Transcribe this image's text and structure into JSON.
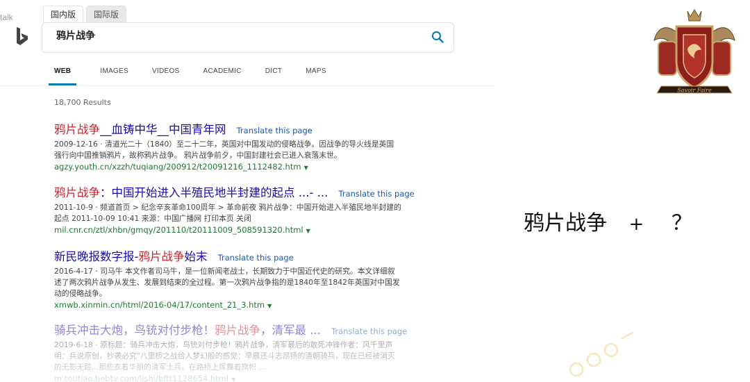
{
  "corner_text": "talk",
  "market_tabs": [
    {
      "label": "国内版"
    },
    {
      "label": "国际版"
    }
  ],
  "search": {
    "value": "鸦片战争"
  },
  "nav": [
    {
      "label": "WEB"
    },
    {
      "label": "IMAGES"
    },
    {
      "label": "VIDEOS"
    },
    {
      "label": "ACADEMIC"
    },
    {
      "label": "DICT"
    },
    {
      "label": "MAPS"
    }
  ],
  "results_count": "18,700 Results",
  "translate_label": "Translate this page",
  "results": [
    {
      "title_parts": [
        "鸦片战争",
        "__血铸中华__中国青年网"
      ],
      "snippet_1": "2009-12-16 · 清道光二十（1840）至二十二年，英国对中国发动的侵略战争。因战争的导火线是英国",
      "snippet_2": "强行向中国推销鸦片，故称鸦片战争。 鸦片战争前夕，中国封建社会已进入衰落末世。",
      "url": "agzy.youth.cn/xzzh/tuqiang/200912/t20091216_1112482.htm"
    },
    {
      "title_parts": [
        "鸦片战争",
        "：中国开始进入半殖民地半封建的起点 ...- ..."
      ],
      "snippet_1": "2011-10-9 · 频道首页 > 纪念辛亥革命100周年 > 革命前夜 鸦片战争：中国开始进入半殖民地半封建的",
      "snippet_2": "起点 2011-10-09 10:41 来源：中国广播网 打印本页 关闭",
      "url": "mil.cnr.cn/ztl/xhbn/gmqy/201110/t20111009_508591320.html"
    },
    {
      "title_parts": [
        "新民晚报数字报-",
        "鸦片战争",
        "始末"
      ],
      "snippet_1": "2016-4-17 · 司马牛 本文作者司马牛，是一位新闻老战士，长期致力于中国近代史的研究。本文详细叙",
      "snippet_2": "述了两次鸦片战争从发生、发展到结束的全过程。第一次鸦片战争指的是1840年至1842年英国对中国发",
      "snippet_3": "动的侵略战争。",
      "url": "xmwb.xinmin.cn/html/2016-04/17/content_21_3.htm"
    },
    {
      "title_parts": [
        "骑兵冲击大炮，鸟铳对付步枪！",
        "鸦片战争",
        "，清军最 ..."
      ],
      "snippet_1": "2019-6-18 · 原标题：骑兵冲击大炮，鸟铳对付步枪！鸦片战争，清军最后的敢死冲锋作者：风千里声",
      "snippet_2": "明：兵说原创，抄袭必究\"八里桥之战给人梦幻般的感觉：早晨还斗志昂扬的清朝骑兵，现在已经被消灭",
      "snippet_3": "的无影无踪...那些衣着华丽的清军士兵，在路桥上挥舞着旗帜 ...",
      "url": "m.toutiao.hebtv.com/lishi/bftt1128654.html"
    }
  ],
  "caption": {
    "query": "鸦片战争",
    "plus": "+",
    "question": "？"
  },
  "colors": {
    "title_link": "#1a0dab",
    "highlight": "#c9252f",
    "url_green": "#1f7a31",
    "tab_underline": "#0a7aa8"
  }
}
